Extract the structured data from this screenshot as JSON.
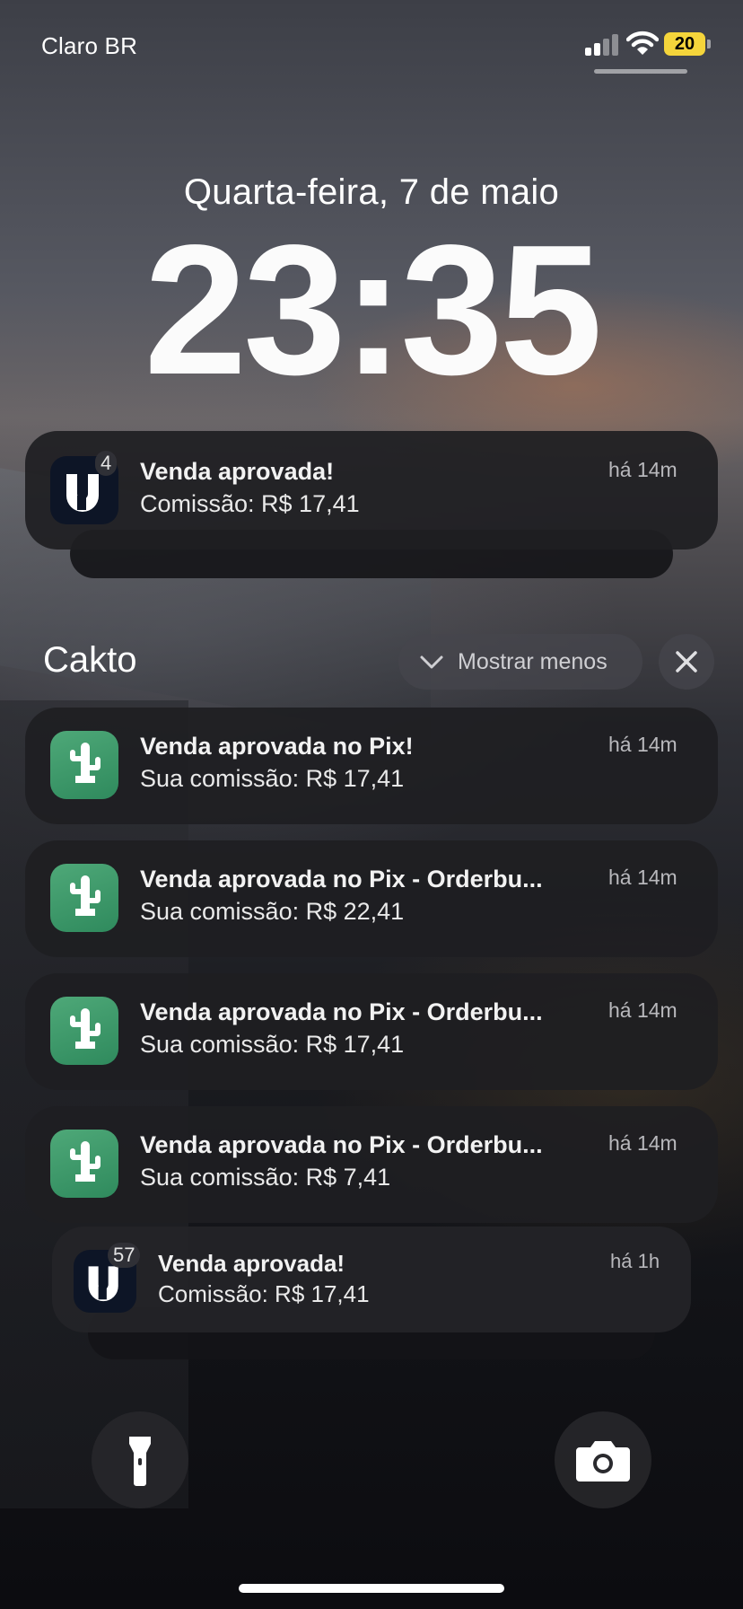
{
  "status_bar": {
    "carrier": "Claro BR",
    "battery": "20",
    "battery_color": "#f5d53b",
    "icons": [
      "cellular-signal-icon",
      "wifi-icon",
      "battery-icon"
    ]
  },
  "lock_screen": {
    "date": "Quarta-feira, 7 de maio",
    "time": "23:35"
  },
  "top_stack": {
    "badge": "4",
    "title": "Venda aprovada!",
    "body": "Comissão: R$ 17,41",
    "time": "há 14m",
    "icon": "u-app-icon"
  },
  "group": {
    "name": "Cakto",
    "show_less": "Mostrar menos",
    "accent": "#3f9b6c",
    "notifications": [
      {
        "title": "Venda aprovada no Pix!",
        "body": "Sua comissão: R$ 17,41",
        "time": "há 14m"
      },
      {
        "title": "Venda aprovada no Pix - Orderbu...",
        "body": "Sua comissão: R$ 22,41",
        "time": "há 14m"
      },
      {
        "title": "Venda aprovada no Pix - Orderbu...",
        "body": "Sua comissão: R$ 17,41",
        "time": "há 14m"
      },
      {
        "title": "Venda aprovada no Pix - Orderbu...",
        "body": "Sua comissão: R$ 7,41",
        "time": "há 14m"
      }
    ]
  },
  "bottom_stack": {
    "badge": "57",
    "title": "Venda aprovada!",
    "body": "Comissão: R$ 17,41",
    "time": "há 1h",
    "icon": "u-app-icon"
  },
  "quick_actions": [
    "flashlight-icon",
    "camera-icon"
  ]
}
